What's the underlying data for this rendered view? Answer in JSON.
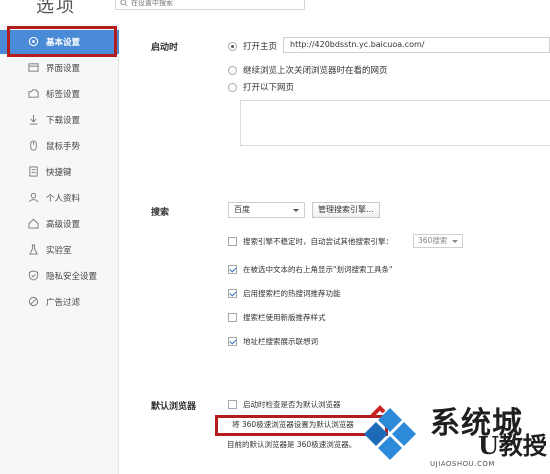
{
  "header": {
    "title": "选项",
    "search_placeholder": "在设置中搜索"
  },
  "sidebar": {
    "items": [
      {
        "label": "基本设置",
        "icon": "settings-circle-icon"
      },
      {
        "label": "界面设置",
        "icon": "window-icon"
      },
      {
        "label": "标签设置",
        "icon": "tab-icon"
      },
      {
        "label": "下载设置",
        "icon": "download-icon"
      },
      {
        "label": "鼠标手势",
        "icon": "mouse-icon"
      },
      {
        "label": "快捷键",
        "icon": "keyboard-icon"
      },
      {
        "label": "个人资料",
        "icon": "user-icon"
      },
      {
        "label": "高级设置",
        "icon": "house-icon"
      },
      {
        "label": "实验室",
        "icon": "lab-icon"
      },
      {
        "label": "隐私安全设置",
        "icon": "shield-icon"
      },
      {
        "label": "广告过滤",
        "icon": "block-icon"
      }
    ],
    "active_index": 0
  },
  "startup": {
    "title": "启动时",
    "option_homepage": "打开主页",
    "homepage_url": "http://420bdsstn.yc.baicuoa.com/",
    "option_continue": "继续浏览上次关闭浏览器时在看的网页",
    "option_pages": "打开以下网页",
    "selected": 0
  },
  "search": {
    "title": "搜索",
    "engine": "百度",
    "manage_label": "管理搜索引擎...",
    "options": [
      {
        "label": "搜索引擎不稳定时，自动尝试其他搜索引擎：",
        "checked": false
      },
      {
        "label": "在被选中文本的右上角显示\"划词搜索工具条\"",
        "checked": true
      },
      {
        "label": "启用搜索栏的热搜词推荐功能",
        "checked": true
      },
      {
        "label": "搜索栏使用新版推荐样式",
        "checked": false
      },
      {
        "label": "地址栏搜索展示联想词",
        "checked": true
      }
    ],
    "fallback_engine": "360搜索"
  },
  "default_browser": {
    "title": "默认浏览器",
    "check_label": "启动时检查是否为默认浏览器",
    "check_checked": false,
    "set_default_label": "将 360极速浏览器设置为默认浏览器",
    "note": "目前的默认浏览器是 360极速浏览器。"
  },
  "watermark": {
    "line1": "系统城",
    "line2": "U教授",
    "site": "UJIAOSHOU.COM"
  },
  "colors": {
    "accent": "#4a8bd8",
    "highlight_red": "#b41d1d",
    "sidebar_bg": "#f6f7f9"
  }
}
